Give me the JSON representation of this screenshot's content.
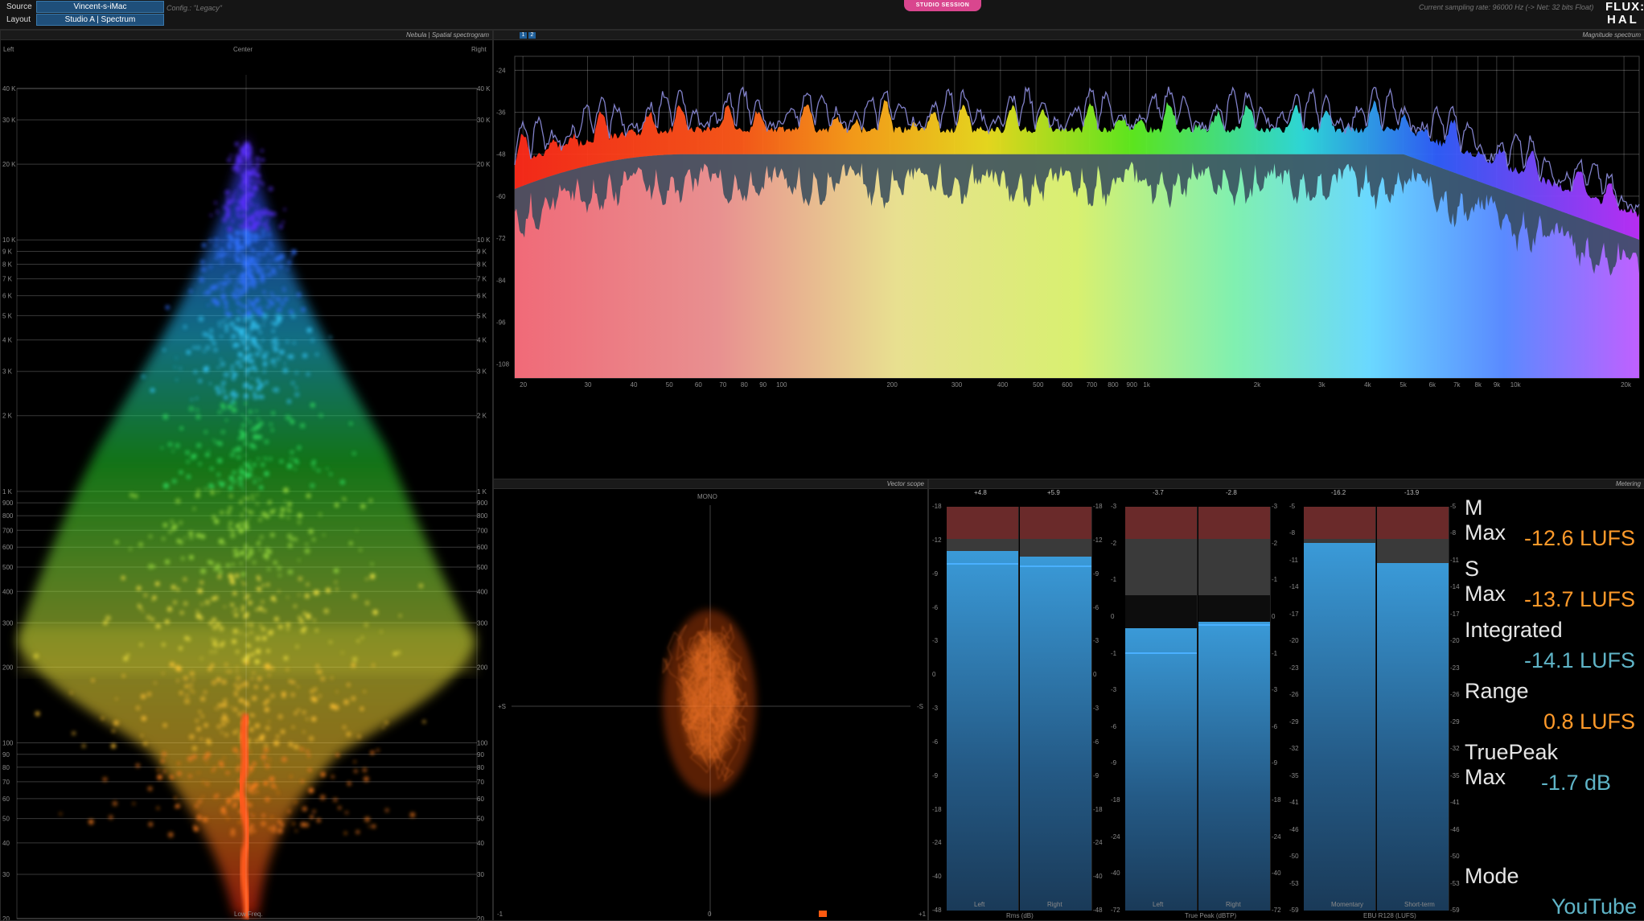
{
  "topbar": {
    "source_label": "Source",
    "source_value": "Vincent-s-iMac",
    "layout_label": "Layout",
    "layout_value": "Studio A | Spectrum",
    "config": "Config.: \"Legacy\"",
    "studio_session": "STUDIO SESSION",
    "sampling_info": "Current sampling rate: 96000 Hz (-> Net: 32 bits Float)",
    "logo_top": "FLUX:",
    "logo_bottom": "HAL"
  },
  "nebula": {
    "title": "Nebula | Spatial spectrogram",
    "left": "Left",
    "center": "Center",
    "right": "Right",
    "bottom": "Low Freq.",
    "freq_ticks": [
      "40 K",
      "30 K",
      "20 K",
      "10 K",
      "9 K",
      "8 K",
      "7 K",
      "6 K",
      "5 K",
      "4 K",
      "3 K",
      "2 K",
      "1 K",
      "900",
      "800",
      "700",
      "600",
      "500",
      "400",
      "300",
      "200",
      "100",
      "90",
      "80",
      "70",
      "60",
      "50",
      "40",
      "30",
      "20"
    ]
  },
  "spectrum": {
    "title": "Magnitude spectrum",
    "toolbar_1": "1",
    "toolbar_2": "2",
    "db_ticks": [
      "-24",
      "-36",
      "-48",
      "-60",
      "-72",
      "-84",
      "-96",
      "-108"
    ],
    "freq_ticks": [
      "20",
      "30",
      "40",
      "50",
      "60",
      "70",
      "80",
      "90",
      "100",
      "200",
      "300",
      "400",
      "500",
      "600",
      "700",
      "800",
      "900",
      "1k",
      "2k",
      "3k",
      "4k",
      "5k",
      "6k",
      "7k",
      "8k",
      "9k",
      "10k",
      "20k"
    ]
  },
  "vector": {
    "title": "Vector scope",
    "top": "MONO",
    "left": "+S",
    "right": "-S",
    "bottom_left": "-1",
    "bottom_center": "0",
    "bottom_right": "+1"
  },
  "metering": {
    "title": "Metering",
    "groups": [
      {
        "footer": "Rms (dB)",
        "peaks": [
          "+4.8",
          "+5.9"
        ],
        "channels": [
          "Left",
          "Right"
        ],
        "left_ticks": [
          "-18",
          "-12",
          "-9",
          "-6",
          "-3",
          "0",
          "-3",
          "-6",
          "-9",
          "-18",
          "-24",
          "-40",
          "-48"
        ],
        "right_ticks": [
          "-18",
          "-12",
          "-9",
          "-6",
          "-3",
          "0",
          "-3",
          "-6",
          "-9",
          "-18",
          "-24",
          "-40",
          "-48"
        ]
      },
      {
        "footer": "True Peak (dBTP)",
        "peaks": [
          "-3.7",
          "-2.8"
        ],
        "channels": [
          "Left",
          "Right"
        ],
        "left_ticks": [
          "-3",
          "-2",
          "-1",
          "0",
          "-1",
          "-3",
          "-6",
          "-9",
          "-18",
          "-24",
          "-40",
          "-72"
        ],
        "right_ticks": [
          "-3",
          "-2",
          "-1",
          "0",
          "-1",
          "-3",
          "-6",
          "-9",
          "-18",
          "-24",
          "-40",
          "-72"
        ]
      },
      {
        "footer": "EBU R128 (LUFS)",
        "peaks": [
          "-16.2",
          "-13.9"
        ],
        "channels": [
          "Momentary",
          "Short-term"
        ],
        "left_ticks": [
          "-5",
          "-8",
          "-11",
          "-14",
          "-17",
          "-20",
          "-23",
          "-26",
          "-29",
          "-32",
          "-35",
          "-41",
          "-46",
          "-50",
          "-53",
          "-59"
        ],
        "right_ticks": [
          "-5",
          "-8",
          "-11",
          "-14",
          "-17",
          "-20",
          "-23",
          "-26",
          "-29",
          "-32",
          "-35",
          "-41",
          "-46",
          "-50",
          "-53",
          "-59"
        ]
      }
    ],
    "readouts": [
      {
        "label": "M Max",
        "value": "-12.6 LUFS",
        "color": "#ff9a2a"
      },
      {
        "label": "S Max",
        "value": "-13.7 LUFS",
        "color": "#ff9a2a"
      },
      {
        "label": "Integrated",
        "value": "-14.1 LUFS",
        "color": "#5fb4c7"
      },
      {
        "label": "Range",
        "value": "0.8 LUFS",
        "color": "#ff9a2a"
      },
      {
        "label": "TruePeak Max",
        "value": "-1.7 dB",
        "color": "#5fb4c7"
      }
    ],
    "mode_label": "Mode",
    "mode_value": "YouTube",
    "mode_color": "#5fb4c7"
  }
}
